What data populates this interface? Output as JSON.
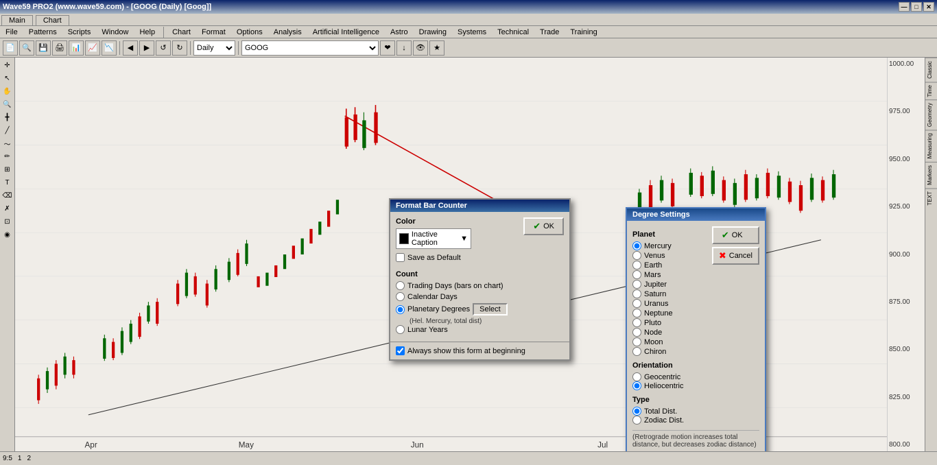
{
  "app": {
    "title": "Wave59 PRO2 (www.wave59.com) - [GOOG (Daily) [Goog]]",
    "main_label": "Main",
    "chart_label": "Chart"
  },
  "title_buttons": {
    "minimize": "—",
    "maximize": "□",
    "close": "✕"
  },
  "main_menu": [
    "File",
    "Patterns",
    "Scripts",
    "Window",
    "Help"
  ],
  "chart_menu": [
    "Chart",
    "Format",
    "Options",
    "Analysis",
    "Artificial Intelligence",
    "Astro",
    "Drawing",
    "Systems",
    "Technical",
    "Trade",
    "Training"
  ],
  "toolbar": {
    "interval": "Daily"
  },
  "format_bar_counter": {
    "title": "Format Bar Counter",
    "color_label": "Color",
    "color_value": "Inactive Caption",
    "save_default_label": "Save as Default",
    "count_label": "Count",
    "options": [
      "Trading Days (bars on chart)",
      "Calendar Days",
      "Planetary Degrees",
      "Lunar Years"
    ],
    "select_label": "Select",
    "planetary_sub": "(Hel.  Mercury, total dist)",
    "always_show_label": "Always show this form at beginning",
    "ok_label": "OK"
  },
  "degree_settings": {
    "title": "Degree Settings",
    "planet_label": "Planet",
    "planets": [
      "Mercury",
      "Venus",
      "Earth",
      "Mars",
      "Jupiter",
      "Saturn",
      "Uranus",
      "Neptune",
      "Pluto",
      "Node",
      "Moon",
      "Chiron"
    ],
    "selected_planet": "Mercury",
    "orientation_label": "Orientation",
    "orientations": [
      "Geocentric",
      "Heliocentric"
    ],
    "selected_orientation": "Heliocentric",
    "type_label": "Type",
    "types": [
      "Total Dist.",
      "Zodiac Dist."
    ],
    "selected_type": "Total Dist.",
    "footnote": "(Retrograde motion increases total distance, but decreases zodiac distance)",
    "ok_label": "OK",
    "cancel_label": "Cancel"
  },
  "price_levels": [
    "1000.00",
    "975.00",
    "950.00",
    "925.00",
    "900.00",
    "875.00",
    "850.00",
    "825.00",
    "800.00"
  ],
  "month_labels": [
    "Apr",
    "May",
    "Jun",
    "Jul"
  ],
  "bottom_status": [
    "9:5",
    "1",
    "2"
  ],
  "right_tabs": [
    "Classic",
    "Time",
    "Geometry",
    "Measuring",
    "Markers",
    "TEXT"
  ]
}
